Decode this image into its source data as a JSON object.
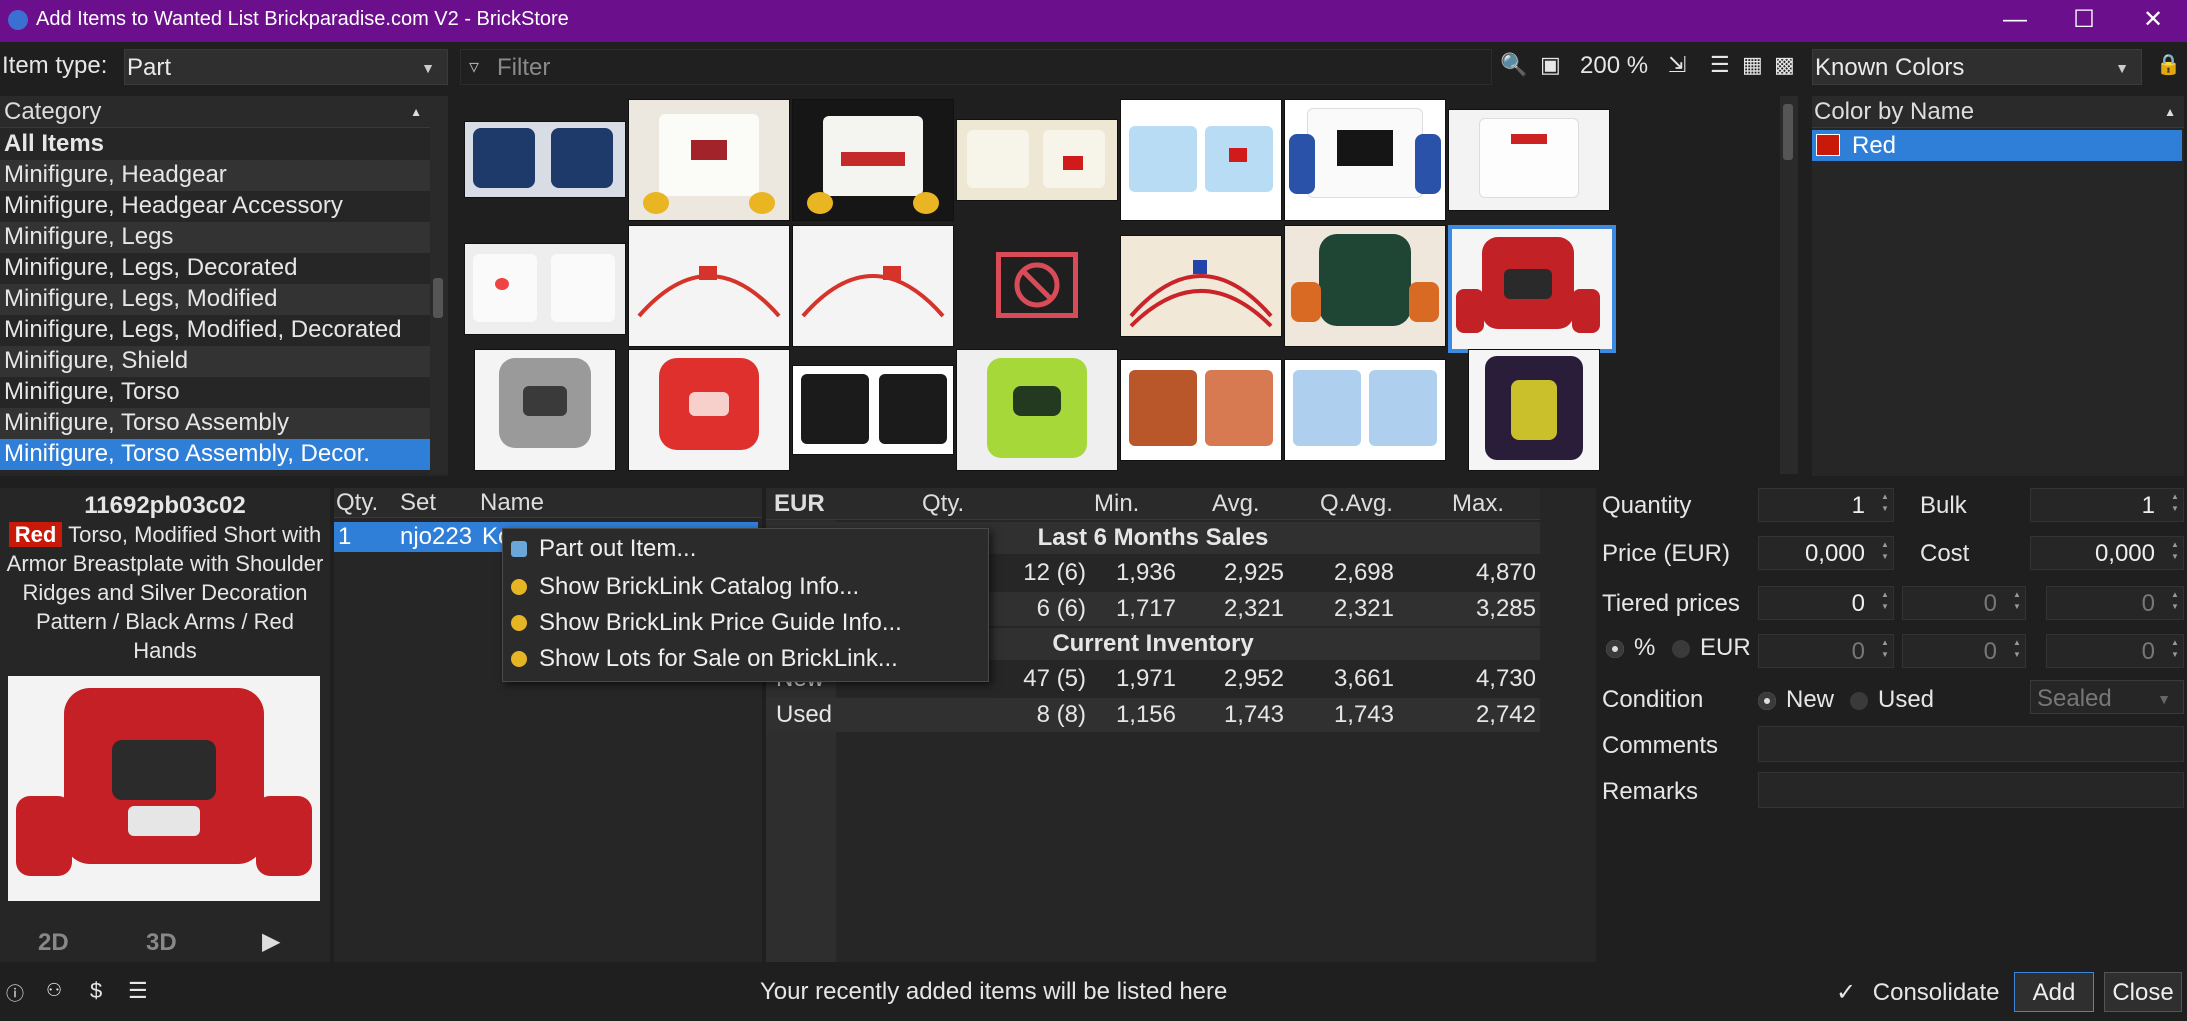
{
  "window": {
    "title": "Add Items to Wanted List Brickparadise.com V2 - BrickStore"
  },
  "toolbar": {
    "item_type_label": "Item type:",
    "item_type_value": "Part",
    "filter_placeholder": "Filter",
    "zoom": "200 %",
    "colors_combo": "Known Colors"
  },
  "category": {
    "header": "Category",
    "items": [
      {
        "label": "All Items"
      },
      {
        "label": "Minifigure, Headgear"
      },
      {
        "label": "Minifigure, Headgear Accessory"
      },
      {
        "label": "Minifigure, Legs"
      },
      {
        "label": "Minifigure, Legs, Decorated"
      },
      {
        "label": "Minifigure, Legs, Modified"
      },
      {
        "label": "Minifigure, Legs, Modified, Decorated"
      },
      {
        "label": "Minifigure, Shield"
      },
      {
        "label": "Minifigure, Torso"
      },
      {
        "label": "Minifigure, Torso Assembly"
      },
      {
        "label": "Minifigure, Torso Assembly, Decor."
      }
    ]
  },
  "colors": {
    "header": "Color by Name",
    "items": [
      {
        "label": "Red",
        "swatch": "#c91a09"
      }
    ]
  },
  "item": {
    "id": "11692pb03c02",
    "color_badge": "Red",
    "description": "Torso, Modified Short with Armor Breastplate with Shoulder Ridges and Silver Decoration Pattern / Black Arms / Red Hands",
    "view_2d": "2D",
    "view_3d": "3D",
    "play_icon": "▶"
  },
  "appears_in": {
    "headers": {
      "qty": "Qty.",
      "set": "Set",
      "name": "Name"
    },
    "rows": [
      {
        "qty": "1",
        "set": "njo223",
        "name": "Ko"
      }
    ]
  },
  "context_menu": {
    "items": [
      {
        "label": "Part out Item...",
        "icon": "package-icon"
      },
      {
        "label": "Show BrickLink Catalog Info...",
        "icon": "bricklink-icon"
      },
      {
        "label": "Show BrickLink Price Guide Info...",
        "icon": "bricklink-icon"
      },
      {
        "label": "Show Lots for Sale on BrickLink...",
        "icon": "bricklink-icon"
      }
    ]
  },
  "price_guide": {
    "currency": "EUR",
    "headers": [
      "Qty.",
      "Min.",
      "Avg.",
      "Q.Avg.",
      "Max."
    ],
    "sections": [
      {
        "title": "Last 6 Months Sales",
        "rows": [
          {
            "label": "",
            "qty": "12 (6)",
            "min": "1,936",
            "avg": "2,925",
            "qavg": "2,698",
            "max": "4,870"
          },
          {
            "label": "",
            "qty": "6 (6)",
            "min": "1,717",
            "avg": "2,321",
            "qavg": "2,321",
            "max": "3,285"
          }
        ]
      },
      {
        "title": "Current Inventory",
        "rows": [
          {
            "label": "New",
            "qty": "47 (5)",
            "min": "1,971",
            "avg": "2,952",
            "qavg": "3,661",
            "max": "4,730"
          },
          {
            "label": "Used",
            "qty": "8 (8)",
            "min": "1,156",
            "avg": "1,743",
            "qavg": "1,743",
            "max": "2,742"
          }
        ]
      }
    ]
  },
  "form": {
    "quantity_label": "Quantity",
    "quantity": "1",
    "bulk_label": "Bulk",
    "bulk": "1",
    "price_label": "Price (EUR)",
    "price": "0,000",
    "cost_label": "Cost",
    "cost": "0,000",
    "tiered_label": "Tiered prices",
    "tier1": "0",
    "tier2": "0",
    "tier3": "0",
    "pct_label": "%",
    "eur_label": "EUR",
    "tierp1": "0",
    "tierp2": "0",
    "tierp3": "0",
    "condition_label": "Condition",
    "new_label": "New",
    "used_label": "Used",
    "sealed": "Sealed",
    "comments_label": "Comments",
    "remarks_label": "Remarks"
  },
  "statusbar": {
    "message": "Your recently added items will be listed here",
    "consolidate": "Consolidate",
    "add": "Add",
    "close": "Close"
  },
  "accent": "#2f7fd9",
  "titlebar_color": "#6b0f8c"
}
